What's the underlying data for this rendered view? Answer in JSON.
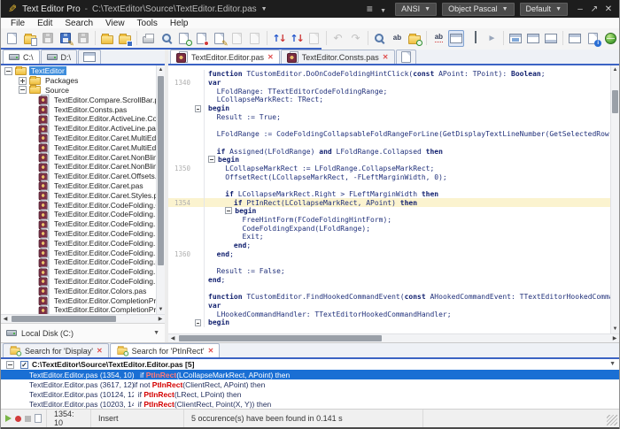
{
  "window": {
    "app_title": "Text Editor Pro",
    "title_separator": "-",
    "file_path": "C:\\TextEditor\\Source\\TextEditor.Editor.pas",
    "encoding": "ANSI",
    "syntax": "Object Pascal",
    "theme": "Default"
  },
  "menu_bar": [
    "File",
    "Edit",
    "Search",
    "View",
    "Tools",
    "Help"
  ],
  "toolbar_icons": [
    {
      "name": "new-file",
      "prim": "page"
    },
    {
      "name": "open-file",
      "prim": "folder",
      "ov": "page"
    },
    {
      "name": "save-file",
      "prim": "disk",
      "disabled": true
    },
    {
      "name": "save-file-as",
      "prim": "disk",
      "ov": "pencil"
    },
    {
      "name": "save-all",
      "prim": "disk",
      "disabled": true
    },
    {
      "sep": true
    },
    {
      "name": "open-folder",
      "prim": "folder"
    },
    {
      "name": "save-to-folder",
      "prim": "folder",
      "ov": "disk"
    },
    {
      "sep": true
    },
    {
      "name": "print",
      "prim": "print"
    },
    {
      "name": "find",
      "prim": "mag"
    },
    {
      "name": "find-in-files",
      "prim": "page",
      "ov": "mag"
    },
    {
      "name": "replace",
      "prim": "page",
      "ov": "red-dot"
    },
    {
      "name": "replace-in-files",
      "prim": "page",
      "ov": "pencil"
    },
    {
      "name": "find-previous",
      "prim": "page",
      "disabled": true
    },
    {
      "name": "find-next",
      "prim": "page",
      "disabled": true
    },
    {
      "sep": true
    },
    {
      "name": "sort-ascending",
      "prim": "arrows"
    },
    {
      "name": "sort-descending",
      "prim": "arrows"
    },
    {
      "name": "toggle-case",
      "prim": "page",
      "disabled": true
    },
    {
      "sep": true
    },
    {
      "name": "undo",
      "prim": "undo",
      "disabled": true
    },
    {
      "name": "redo",
      "prim": "redo",
      "disabled": true
    },
    {
      "sep": true
    },
    {
      "name": "zoom",
      "prim": "mag"
    },
    {
      "name": "style-select",
      "prim": "ab"
    },
    {
      "name": "compare-files",
      "prim": "folder",
      "ov": "mag"
    },
    {
      "sep": true
    },
    {
      "name": "spell-check",
      "prim": "abc"
    },
    {
      "name": "sidebar-toggle",
      "prim": "win",
      "pressed": true
    },
    {
      "name": "bookmark",
      "prim": "flag"
    },
    {
      "name": "selection-mode",
      "prim": "cursor"
    },
    {
      "sep": true
    },
    {
      "name": "preview",
      "prim": "win-img"
    },
    {
      "name": "split-horizontal",
      "prim": "win"
    },
    {
      "name": "split-bottom",
      "prim": "win-b"
    },
    {
      "sep": true
    },
    {
      "name": "swap-view",
      "prim": "win"
    },
    {
      "name": "file-info",
      "prim": "page",
      "ov": "info"
    },
    {
      "name": "open-in-browser",
      "prim": "globe"
    }
  ],
  "sidebar": {
    "drive_tabs": [
      {
        "label": "C:\\",
        "active": true
      },
      {
        "label": "D:\\",
        "active": false
      }
    ],
    "tree": {
      "root": {
        "label": "TextEditor"
      },
      "folders": [
        {
          "label": "Packages",
          "expanded": false
        },
        {
          "label": "Source",
          "expanded": true
        }
      ],
      "files": [
        "TextEditor.Compare.ScrollBar.pas",
        "TextEditor.Consts.pas",
        "TextEditor.Editor.ActiveLine.Colors.",
        "TextEditor.Editor.ActiveLine.pas",
        "TextEditor.Editor.Caret.MultiEdit.Co",
        "TextEditor.Editor.Caret.MultiEdit.pa",
        "TextEditor.Editor.Caret.NonBlinking",
        "TextEditor.Editor.Caret.NonBlinking",
        "TextEditor.Editor.Caret.Offsets.pas",
        "TextEditor.Editor.Caret.pas",
        "TextEditor.Editor.Caret.Styles.pas",
        "TextEditor.Editor.CodeFolding.Color",
        "TextEditor.Editor.CodeFolding.Hint.",
        "TextEditor.Editor.CodeFolding.Hint.",
        "TextEditor.Editor.CodeFolding.Hint.",
        "TextEditor.Editor.CodeFolding.Hint.",
        "TextEditor.Editor.CodeFolding.Hint.",
        "TextEditor.Editor.CodeFolding.pas",
        "TextEditor.Editor.CodeFolding.Rang",
        "TextEditor.Editor.CodeFolding.Regio",
        "TextEditor.Editor.Colors.pas",
        "TextEditor.Editor.CompletionPropos",
        "TextEditor.Editor.CompletionPropos"
      ]
    },
    "footer": {
      "label": "Local Disk (C:)"
    }
  },
  "editor": {
    "tabs": [
      {
        "label": "TextEditor.Editor.pas",
        "active": true
      },
      {
        "label": "TextEditor.Consts.pas",
        "active": false
      }
    ],
    "lines": [
      {
        "n": "",
        "s": [
          [
            "k",
            "function "
          ],
          [
            "p",
            "TCustomEditor.DoOnCodeFoldingHintClick("
          ],
          [
            "k",
            "const"
          ],
          [
            "p",
            " APoint: TPoint): "
          ],
          [
            "k",
            "Boolean"
          ],
          [
            "p",
            ";"
          ]
        ]
      },
      {
        "n": "1340",
        "s": [
          [
            "k",
            "var"
          ]
        ]
      },
      {
        "n": "",
        "s": [
          [
            "p",
            "  LFoldRange: TTextEditorCodeFoldingRange;"
          ]
        ]
      },
      {
        "n": "",
        "s": [
          [
            "p",
            "  LCollapseMarkRect: TRect;"
          ]
        ]
      },
      {
        "n": "",
        "f": true,
        "s": [
          [
            "k",
            "begin"
          ]
        ]
      },
      {
        "n": "",
        "s": [
          [
            "p",
            "  Result := True;"
          ]
        ]
      },
      {
        "n": "",
        "s": []
      },
      {
        "n": "",
        "s": [
          [
            "p",
            "  LFoldRange := CodeFoldingCollapsableFoldRangeForLine(GetDisplayTextLineNumber(GetSelectedRow(APoint.Y)"
          ]
        ]
      },
      {
        "n": "",
        "s": []
      },
      {
        "n": "",
        "s": [
          [
            "p",
            "  "
          ],
          [
            "k",
            "if"
          ],
          [
            "p",
            " Assigned(LFoldRange) "
          ],
          [
            "k",
            "and"
          ],
          [
            "p",
            " LFoldRange.Collapsed "
          ],
          [
            "k",
            "then"
          ]
        ]
      },
      {
        "n": "",
        "s": [
          [
            "x",
            ""
          ],
          [
            "k",
            "begin"
          ]
        ]
      },
      {
        "n": "1350",
        "s": [
          [
            "p",
            "    LCollapseMarkRect := LFoldRange.CollapseMarkRect;"
          ]
        ]
      },
      {
        "n": "",
        "s": [
          [
            "p",
            "    OffsetRect(LCollapseMarkRect, -FLeftMarginWidth, 0);"
          ]
        ]
      },
      {
        "n": "",
        "s": []
      },
      {
        "n": "",
        "s": [
          [
            "p",
            "    "
          ],
          [
            "k",
            "if"
          ],
          [
            "p",
            " LCollapseMarkRect.Right > FLeftMarginWidth "
          ],
          [
            "k",
            "then"
          ]
        ]
      },
      {
        "n": "1354",
        "hl": true,
        "s": [
          [
            "p",
            "      "
          ],
          [
            "k",
            "if"
          ],
          [
            "p",
            " PtInRect(LCollapseMarkRect, APoint) "
          ],
          [
            "k",
            "then"
          ]
        ]
      },
      {
        "n": "",
        "s": [
          [
            "p",
            "    "
          ],
          [
            "x",
            ""
          ],
          [
            "k",
            "begin"
          ]
        ]
      },
      {
        "n": "",
        "s": [
          [
            "p",
            "        FreeHintForm(FCodeFoldingHintForm);"
          ]
        ]
      },
      {
        "n": "",
        "s": [
          [
            "p",
            "        CodeFoldingExpand(LFoldRange);"
          ]
        ]
      },
      {
        "n": "",
        "s": [
          [
            "p",
            "        Exit;"
          ]
        ]
      },
      {
        "n": "",
        "s": [
          [
            "p",
            "      "
          ],
          [
            "k",
            "end"
          ],
          [
            "p",
            ";"
          ]
        ]
      },
      {
        "n": "1360",
        "s": [
          [
            "p",
            "  "
          ],
          [
            "k",
            "end"
          ],
          [
            "p",
            ";"
          ]
        ]
      },
      {
        "n": "",
        "s": []
      },
      {
        "n": "",
        "s": [
          [
            "p",
            "  Result := False;"
          ]
        ]
      },
      {
        "n": "",
        "s": [
          [
            "k",
            "end"
          ],
          [
            "p",
            ";"
          ]
        ]
      },
      {
        "n": "",
        "s": []
      },
      {
        "n": "",
        "s": [
          [
            "k",
            "function "
          ],
          [
            "p",
            "TCustomEditor.FindHookedCommandEvent("
          ],
          [
            "k",
            "const"
          ],
          [
            "p",
            " AHookedCommandEvent: TTextEditorHookedCommandEvent):"
          ]
        ]
      },
      {
        "n": "",
        "s": [
          [
            "k",
            "var"
          ]
        ]
      },
      {
        "n": "",
        "s": [
          [
            "p",
            "  LHookedCommandHandler: TTextEditorHookedCommandHandler;"
          ]
        ]
      },
      {
        "n": "",
        "f": true,
        "s": [
          [
            "k",
            "begin"
          ]
        ]
      }
    ]
  },
  "search_panel": {
    "tabs": [
      {
        "label": "Search for 'Display'",
        "active": false
      },
      {
        "label": "Search for 'PtInRect'",
        "active": true
      }
    ],
    "group": {
      "path": "C:\\TextEditor\\Source\\TextEditor.Editor.pas",
      "count": "[5]"
    },
    "results": [
      {
        "file": "TextEditor.Editor.pas",
        "pos": "(1354, 10):",
        "code_pre": "   if ",
        "match": "PtInRect",
        "code_post": "(LCollapseMarkRect, APoint) then",
        "selected": true
      },
      {
        "file": "TextEditor.Editor.pas",
        "pos": "(3617, 12):",
        "code_pre": "if not ",
        "match": "PtInRect",
        "code_post": "(ClientRect, APoint) then",
        "selected": false
      },
      {
        "file": "TextEditor.Editor.pas",
        "pos": "(10124, 12):",
        "code_pre": "  if ",
        "match": "PtInRect",
        "code_post": "(LRect, LPoint) then",
        "selected": false
      },
      {
        "file": "TextEditor.Editor.pas",
        "pos": "(10203, 14):",
        "code_pre": "  if ",
        "match": "PtInRect",
        "code_post": "(ClientRect, Point(X, Y)) then",
        "selected": false
      }
    ]
  },
  "status_bar": {
    "caret": "1354: 10",
    "mode": "Insert",
    "message": "5 occurence(s) have been found in 0.141 s"
  }
}
